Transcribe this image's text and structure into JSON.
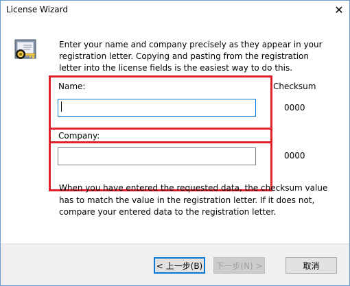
{
  "window": {
    "title": "License Wizard",
    "close_symbol": "✕"
  },
  "intro": "Enter your name and company precisely as they appear in your registration letter.  Copying and pasting from the registration letter into the license fields is the easiest way to do this.",
  "checksum_header": "Checksum",
  "name_field": {
    "label": "Name:",
    "value": "",
    "checksum": "0000"
  },
  "company_field": {
    "label": "Company:",
    "value": "",
    "checksum": "0000"
  },
  "note": "When you have entered the requested data, the checksum value has to match the value in the registration letter.  If it does not, compare your entered data to the registration letter.",
  "buttons": {
    "back": "< 上一步(B)",
    "next": "下一步(N) >",
    "cancel": "取消"
  },
  "colors": {
    "highlight": "#e0202a",
    "focus": "#0078d7"
  },
  "icons": {
    "wizard": "certificate-lock-icon"
  }
}
